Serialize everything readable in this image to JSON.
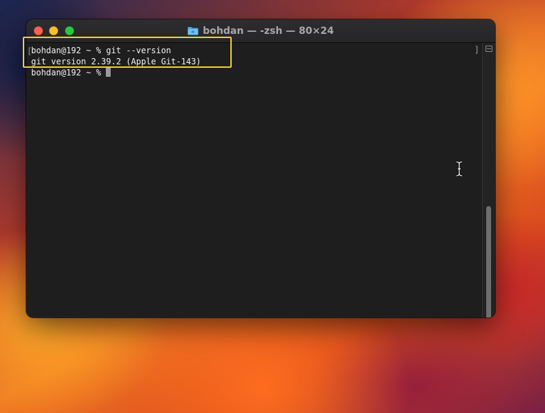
{
  "window": {
    "title": "bohdan — -zsh — 80×24",
    "folder_icon": "folder-icon"
  },
  "terminal": {
    "lines": [
      "bohdan@192 ~ % git --version",
      "git version 2.39.2 (Apple Git-143)",
      "bohdan@192 ~ % "
    ],
    "left_bracket": "[",
    "right_bracket": "]"
  },
  "colors": {
    "highlight_box": "#f3d51c",
    "terminal_bg": "#1e1e1e",
    "close": "#ff5f57",
    "minimize": "#febc2e",
    "zoom": "#28c840"
  },
  "icons": {
    "cursor": "i-beam-cursor-icon",
    "scroll": "scroll-toggle-icon"
  }
}
